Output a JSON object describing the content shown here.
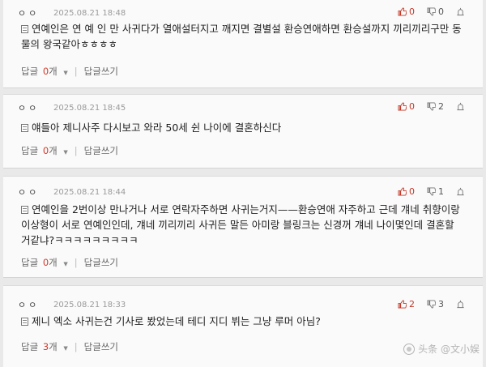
{
  "comments": [
    {
      "nickname": "ㅇㅇ",
      "date": "2025.08.21 18:48",
      "upvotes": "0",
      "downvotes": "0",
      "text": "연예인은 연 예 인 만 사귀다가 열애설터지고 깨지면 결별설 환승연애하면 환승설까지 끼리끼리구만 동물의 왕국같아ㅎㅎㅎㅎ",
      "reply_label": "답글",
      "reply_count": "0",
      "reply_unit": "개",
      "write_label": "답글쓰기"
    },
    {
      "nickname": "ㅇㅇ",
      "date": "2025.08.21 18:45",
      "upvotes": "0",
      "downvotes": "2",
      "text": "얘들아 제니사주 다시보고 와라 50세 쉰 나이에 결혼하신다",
      "reply_label": "답글",
      "reply_count": "0",
      "reply_unit": "개",
      "write_label": "답글쓰기"
    },
    {
      "nickname": "ㅇㅇ",
      "date": "2025.08.21 18:44",
      "upvotes": "0",
      "downvotes": "1",
      "text": "연예인을 2번이상 만나거나 서로 연락자주하면 사귀는거지——환승연애 자주하고 근데 걔네 취향이랑 이상형이 서로 연예인인데, 걔네 끼리끼리 사귀든 말든 아미랑 블링크는 신경꺼 걔네 나이몇인데 결혼할 거같냐?ㅋㅋㅋㅋㅋㅋㅋㅋㅋ",
      "reply_label": "답글",
      "reply_count": "0",
      "reply_unit": "개",
      "write_label": "답글쓰기"
    },
    {
      "nickname": "ㅇㅇ",
      "date": "2025.08.21 18:33",
      "upvotes": "2",
      "downvotes": "3",
      "text": "제니 엑소 사귀는건 기사로 봤었는데 테디 지디 뷔는 그냥 루머 아님?",
      "reply_label": "답글",
      "reply_count": "3",
      "reply_unit": "개",
      "write_label": "답글쓰기"
    }
  ],
  "watermark": "头条 @文小娱",
  "colors": {
    "accent_red": "#d23b2c",
    "background": "#e9e9e9",
    "card": "#fafafa"
  },
  "icons": [
    "thumbs-up-icon",
    "thumbs-down-icon",
    "siren-icon",
    "document-icon",
    "caret-down-icon"
  ]
}
